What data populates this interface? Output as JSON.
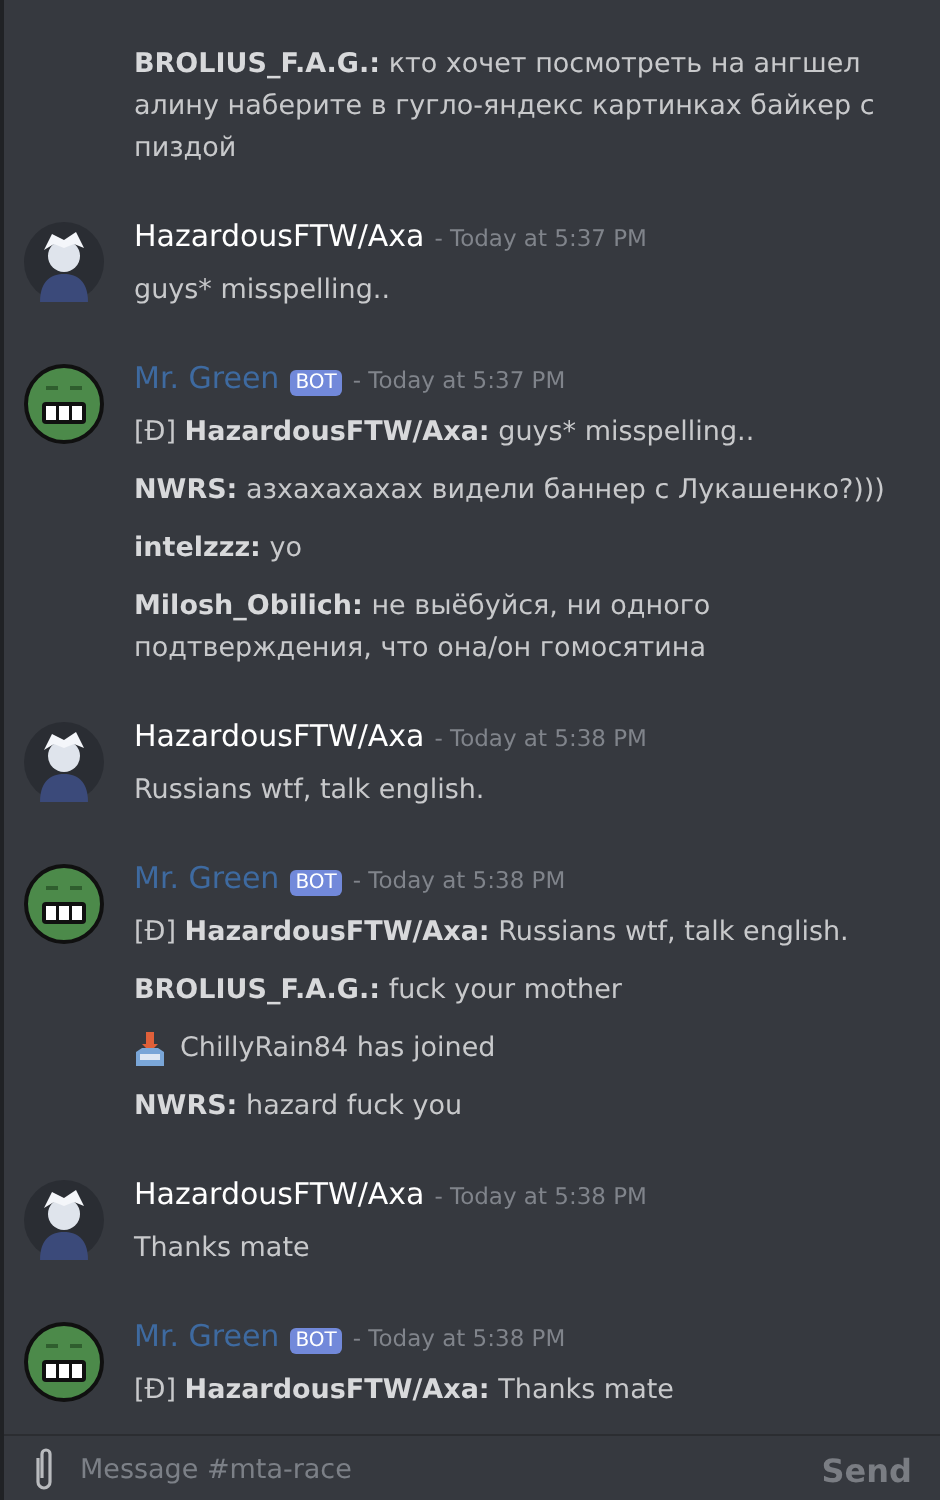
{
  "messages": [
    {
      "kind": "continuation",
      "lines": [
        {
          "kind": "text",
          "sender": "BROLIUS_F.A.G.:",
          "body": "кто хочет посмотреть на ангшел алину наберите в гугло-яндекс картинках байкер с пиздой"
        }
      ]
    },
    {
      "kind": "user",
      "author": "HazardousFTW/Axa",
      "timestamp": "- Today at 5:37 PM",
      "lines": [
        {
          "kind": "text",
          "body": "guys* misspelling.."
        }
      ]
    },
    {
      "kind": "bot",
      "author": "Mr. Green",
      "badge": "BOT",
      "timestamp": "- Today at 5:37 PM",
      "lines": [
        {
          "kind": "text",
          "prefix": "[Đ]",
          "sender": "HazardousFTW/Axa:",
          "body": "guys* misspelling.."
        },
        {
          "kind": "text",
          "sender": "NWRS:",
          "body": "азхахахахах видели баннер с Лукашенко?)))"
        },
        {
          "kind": "text",
          "sender": "intelzzz:",
          "body": "yo"
        },
        {
          "kind": "text",
          "sender": "Milosh_Obilich:",
          "body": "не выёбуйся, ни одного подтверждения, что она/он гомосятина"
        }
      ]
    },
    {
      "kind": "user",
      "author": "HazardousFTW/Axa",
      "timestamp": "- Today at 5:38 PM",
      "lines": [
        {
          "kind": "text",
          "body": "Russians wtf, talk english."
        }
      ]
    },
    {
      "kind": "bot",
      "author": "Mr. Green",
      "badge": "BOT",
      "timestamp": "- Today at 5:38 PM",
      "lines": [
        {
          "kind": "text",
          "prefix": "[Đ]",
          "sender": "HazardousFTW/Axa:",
          "body": "Russians wtf, talk english."
        },
        {
          "kind": "text",
          "sender": "BROLIUS_F.A.G.:",
          "body": "fuck your mother"
        },
        {
          "kind": "join",
          "body": "ChillyRain84 has joined"
        },
        {
          "kind": "text",
          "sender": "NWRS:",
          "body": "hazard fuck you"
        }
      ]
    },
    {
      "kind": "user",
      "author": "HazardousFTW/Axa",
      "timestamp": "- Today at 5:38 PM",
      "lines": [
        {
          "kind": "text",
          "body": "Thanks mate"
        }
      ]
    },
    {
      "kind": "bot",
      "author": "Mr. Green",
      "badge": "BOT",
      "timestamp": "- Today at 5:38 PM",
      "lines": [
        {
          "kind": "text",
          "prefix": "[Đ]",
          "sender": "HazardousFTW/Axa:",
          "body": "Thanks mate"
        }
      ]
    }
  ],
  "composer": {
    "placeholder": "Message #mta-race",
    "send": {
      "label": "Send",
      "disabled": true
    }
  }
}
